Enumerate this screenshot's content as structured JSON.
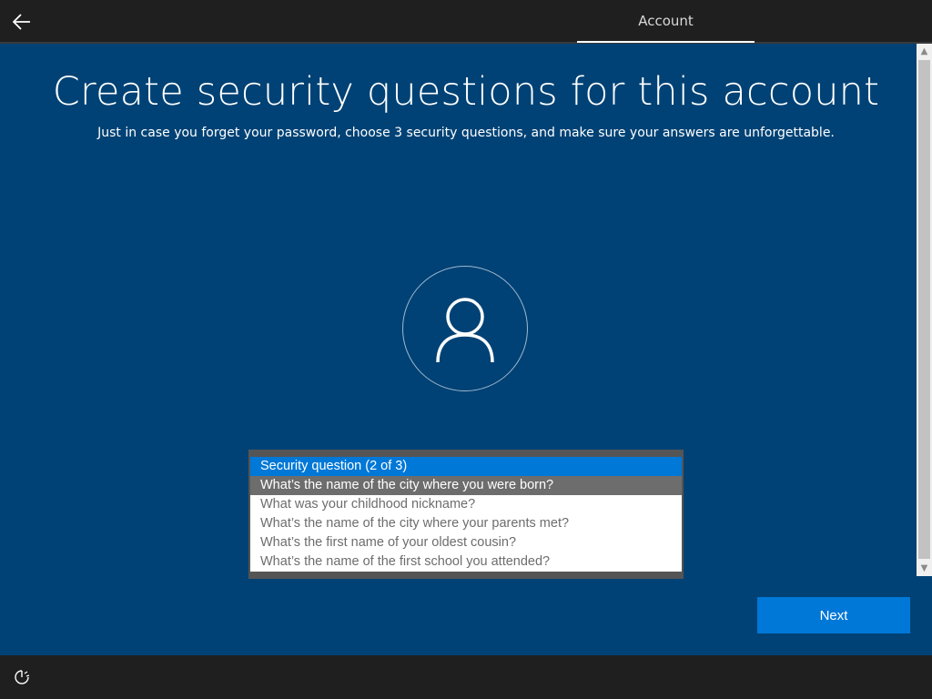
{
  "header": {
    "back_icon": "back-arrow-icon",
    "tab_label": "Account"
  },
  "main": {
    "title": "Create security questions for this account",
    "subtitle": "Just in case you forget your password, choose 3 security questions, and make sure your answers are unforgettable.",
    "avatar_icon": "user-icon"
  },
  "security_question": {
    "header": "Security question (2 of 3)",
    "selected": "What’s the name of the city where you were born?",
    "options": [
      "What was your childhood nickname?",
      "What’s the name of the city where your parents met?",
      "What’s the first name of your oldest cousin?",
      "What’s the name of the first school you attended?"
    ]
  },
  "footer": {
    "next_label": "Next",
    "accessibility_icon": "ease-of-access-icon"
  },
  "colors": {
    "background": "#004275",
    "accent": "#0078d7",
    "bar": "#1f1f1f"
  }
}
